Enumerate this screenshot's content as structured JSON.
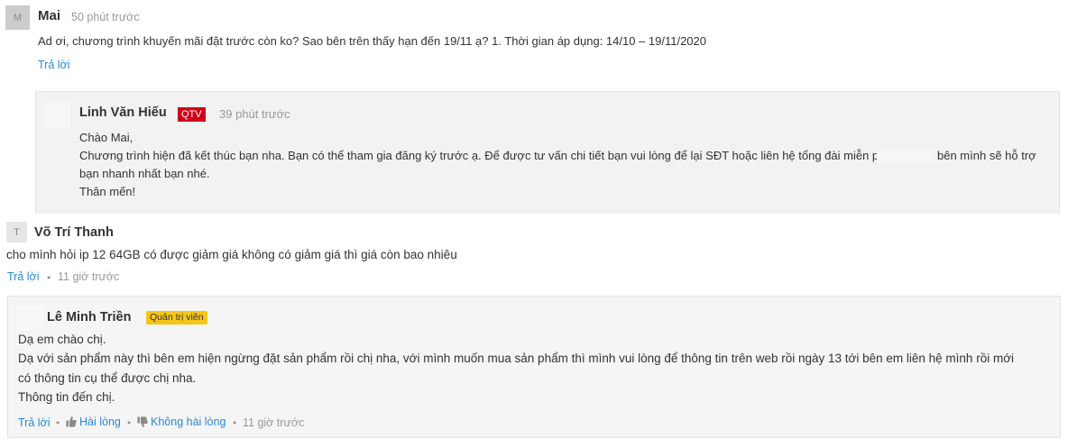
{
  "comment1": {
    "avatar_letter": "M",
    "author": "Mai",
    "time": "50 phút trước",
    "text": "Ad ơi, chương trình khuyến mãi đặt trước còn ko? Sao bên trên thấy hạn đến 19/11 ạ? 1. Thời gian áp dụng: 14/10 – 19/11/2020",
    "reply_label": "Trả lời",
    "reply": {
      "author": "Linh Văn Hiếu",
      "badge": "QTV",
      "time": "39 phút trước",
      "lines": [
        "Chào Mai,",
        "Chương trình hiện đã kết thúc bạn nha. Bạn có thể tham gia đăng ký trước ạ. Để được tư vấn chi tiết bạn vui lòng để lại SĐT hoặc liên hệ tổng đài miễn phí",
        "bên mình sẽ hỗ trợ",
        "bạn nhanh nhất bạn nhé.",
        "Thân mến!"
      ]
    }
  },
  "comment2": {
    "avatar_letter": "T",
    "author": "Võ Trí Thanh",
    "text": "cho mình hỏi ip 12 64GB có được giảm giá không có giảm giá thì giá còn bao nhiêu",
    "reply_label": "Trả lời",
    "separator": "•",
    "time": "11 giờ trước",
    "reply": {
      "author": "Lê Minh Triền",
      "badge": "Quản trị viên",
      "lines": [
        "Dạ em chào chị.",
        "Dạ với sản phẩm này thì bên em hiện ngừng đặt sản phẩm rồi chị nha, với mình muốn mua sản phẩm thì mình vui lòng để thông tin trên web rồi ngày 13 tới bên em liên hệ mình rồi mới",
        "có thông tin cụ thể được chị nha.",
        "Thông tin đến chị."
      ],
      "actions": {
        "reply_label": "Trả lời",
        "like_label": "Hài lòng",
        "dislike_label": "Không hài lòng",
        "separator": "•",
        "time": "11 giờ trước"
      }
    }
  },
  "colors": {
    "link": "#288ad6",
    "qtv_badge": "#d0021b",
    "admin_badge": "#f5c518",
    "reply_bg": "#f2f2f2"
  },
  "icons": {
    "like": "thumbs-up-icon",
    "dislike": "thumbs-down-icon"
  }
}
